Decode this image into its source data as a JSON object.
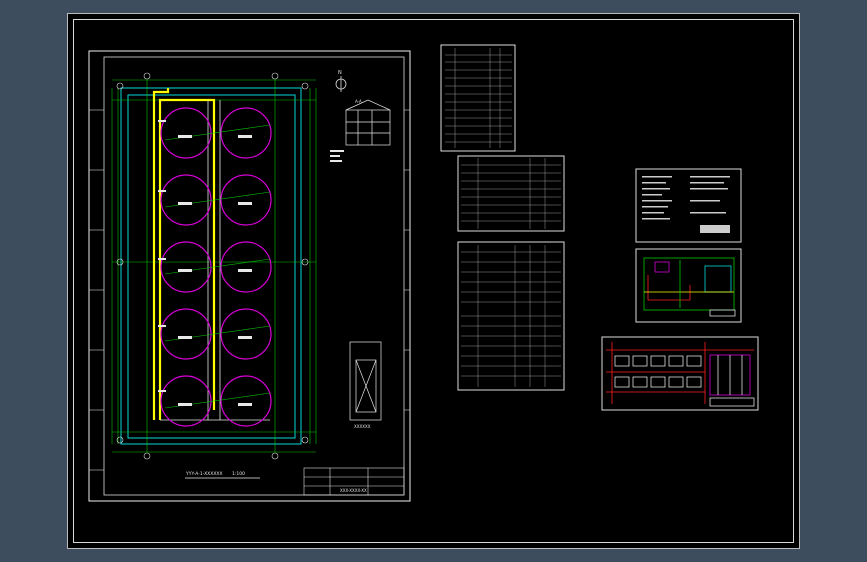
{
  "drawing": {
    "main_plan_title": "YYY-A-1-XXXXXX",
    "main_plan_scale": "1:100",
    "north_label": "N",
    "title_block_name": "XXX-XXXX-XX",
    "detail_label": "XXXXXX",
    "section_label": "A-A"
  },
  "colors": {
    "background": "#3d4d5e",
    "paper": "#000000",
    "tank": "#d400d4",
    "pipe_yellow": "#ffff00",
    "grid_green": "#00d000",
    "wall_cyan": "#00d8d8",
    "red": "#ff2020"
  }
}
